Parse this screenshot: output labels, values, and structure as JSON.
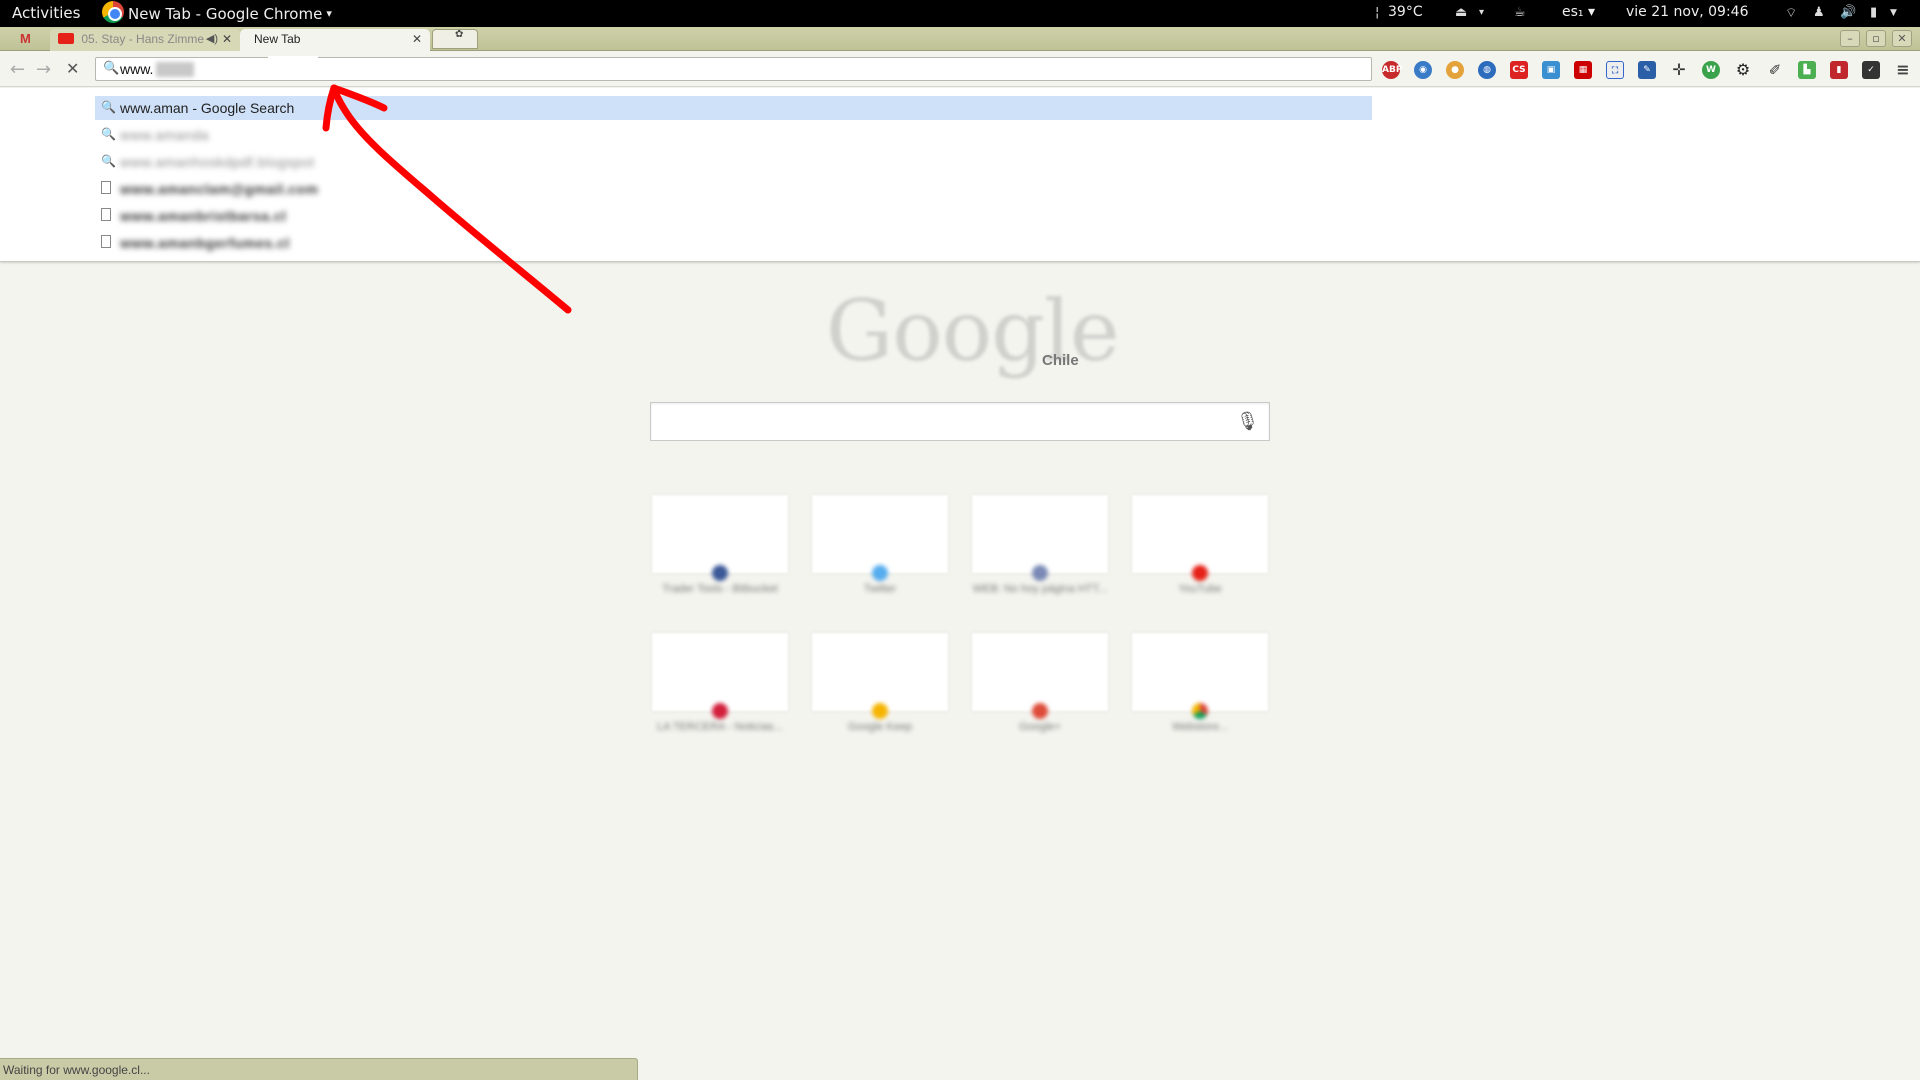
{
  "system_bar": {
    "activities": "Activities",
    "app_title": "New Tab - Google Chrome",
    "app_menu_arrow": "▾",
    "temperature": "39°C",
    "eject_arrow": "▾",
    "keyboard_layout": "es₁ ▾",
    "datetime": "vie 21 nov, 09:46"
  },
  "tabs": [
    {
      "title": "",
      "icon": "gmail-icon"
    },
    {
      "title": "05. Stay - Hans Zimme",
      "icon": "youtube-icon",
      "audio": true
    },
    {
      "title": "New Tab",
      "active": true
    }
  ],
  "omnibox": {
    "typed_text": "www."
  },
  "suggestions": {
    "selected": "www.aman - Google Search",
    "blurred": [
      {
        "text": "www.amanda",
        "type": "search"
      },
      {
        "text": "www.amanhoskdpdf.blogspot",
        "type": "search"
      },
      {
        "text": "www.amanclam@gmail.com",
        "type": "page"
      },
      {
        "text": "www.amanbristbarsa.cl",
        "type": "page"
      },
      {
        "text": "www.amanbgerfumes.cl",
        "type": "page"
      }
    ]
  },
  "ntp": {
    "logo_text": "Google",
    "country": "Chile",
    "tiles": [
      {
        "title": "Trader Tools - Bitbucket",
        "color": "#3b5998"
      },
      {
        "title": "Twitter",
        "color": "#55acee"
      },
      {
        "title": "WEB: No hoy página HTT...",
        "color": "#7a8ab5"
      },
      {
        "title": "YouTube",
        "color": "#e62117"
      },
      {
        "title": "LA TERCERA - Noticias...",
        "color": "#d21f3c"
      },
      {
        "title": "Google Keep",
        "color": "#f6b400"
      },
      {
        "title": "Google+",
        "color": "#dd4b39"
      },
      {
        "title": "Webstore...",
        "color": "#4caf50"
      }
    ]
  },
  "status_bar": "Waiting for www.google.cl...",
  "colors": {
    "annotation": "#ff0000",
    "selection": "#cfe1f8",
    "tabstrip": "#c9cba7"
  }
}
